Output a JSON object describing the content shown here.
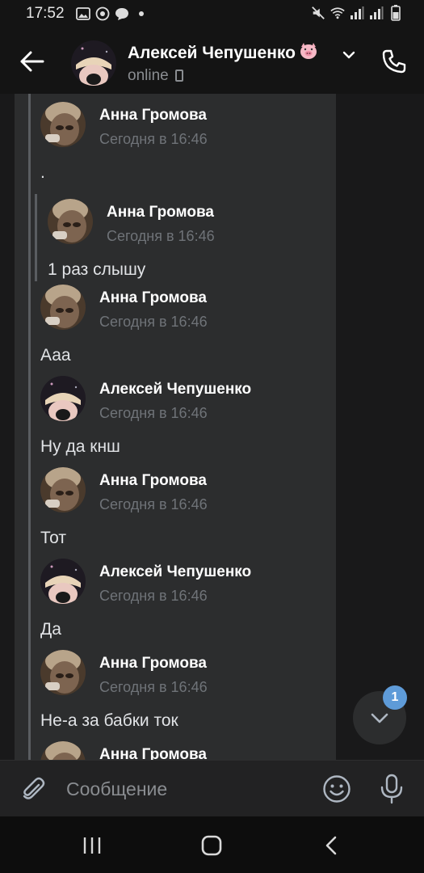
{
  "status_bar": {
    "time": "17:52",
    "icons_left": [
      "image-icon",
      "chrome-icon",
      "chat-bubble-icon",
      "dot-icon"
    ],
    "icons_right": [
      "mute-icon",
      "wifi-icon",
      "signal-icon",
      "signal-icon",
      "battery-icon"
    ]
  },
  "header": {
    "back_icon": "arrow-left-icon",
    "contact_name": "Алексей Чепушенко",
    "contact_emoji": "🐷",
    "status": "online",
    "status_icon": "mobile-phone-icon",
    "call_icon": "phone-icon"
  },
  "messages": [
    {
      "author": "Анна Громова",
      "time": "Сегодня в 16:46",
      "text": "."
    },
    {
      "author": "Анна Громова",
      "time": "Сегодня в 16:46",
      "text": "1 раз слышу",
      "nested": true
    },
    {
      "author": "Анна Громова",
      "time": "Сегодня в 16:46",
      "text": "Ааа"
    },
    {
      "author": "Алексей Чепушенко",
      "time": "Сегодня в 16:46",
      "text": "Ну да кнш"
    },
    {
      "author": "Анна Громова",
      "time": "Сегодня в 16:46",
      "text": "Тот"
    },
    {
      "author": "Алексей Чепушенко",
      "time": "Сегодня в 16:46",
      "text": "Да"
    },
    {
      "author": "Анна Громова",
      "time": "Сегодня в 16:46",
      "text": "Не-а за бабки ток"
    },
    {
      "author": "Анна Громова",
      "time": "",
      "text": ""
    }
  ],
  "scroll_down": {
    "badge": "1",
    "icon": "chevron-down-icon"
  },
  "composer": {
    "placeholder": "Сообщение",
    "attach_icon": "paperclip-icon",
    "emoji_icon": "smiley-icon",
    "mic_icon": "microphone-icon"
  },
  "nav": {
    "recent_icon": "recent-apps-icon",
    "home_icon": "home-icon",
    "back_icon": "nav-back-icon"
  },
  "colors": {
    "background": "#19191a",
    "card": "#2c2d2e",
    "accent": "#5e9bd8",
    "muted": "#6f7378"
  }
}
